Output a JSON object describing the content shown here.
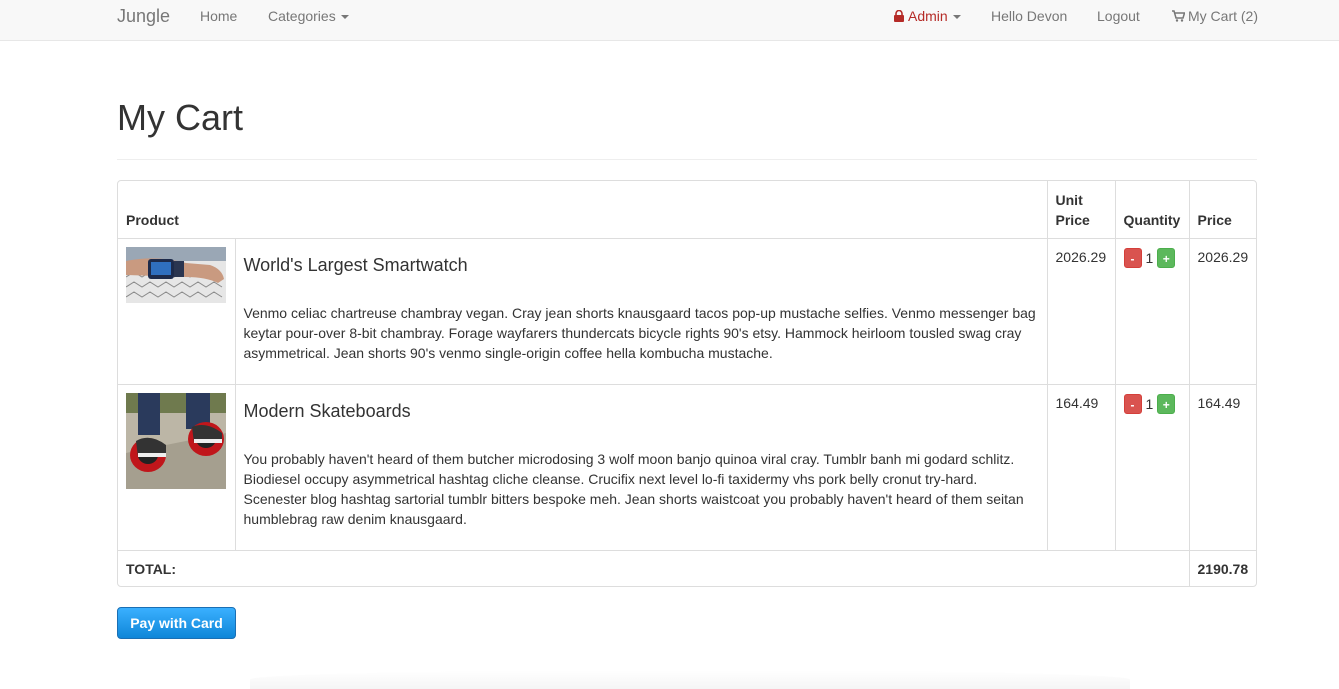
{
  "nav": {
    "brand": "Jungle",
    "home": "Home",
    "categories": "Categories",
    "admin": "Admin",
    "greeting": "Hello Devon",
    "logout": "Logout",
    "cart": "My Cart (2)"
  },
  "page": {
    "title": "My Cart"
  },
  "table": {
    "headers": {
      "product": "Product",
      "unit_price": "Unit Price",
      "quantity": "Quantity",
      "price": "Price"
    },
    "items": [
      {
        "name": "World's Largest Smartwatch",
        "description": "Venmo celiac chartreuse chambray vegan. Cray jean shorts knausgaard tacos pop-up mustache selfies. Venmo messenger bag keytar pour-over 8-bit chambray. Forage wayfarers thundercats bicycle rights 90's etsy. Hammock heirloom tousled swag cray asymmetrical. Jean shorts 90's venmo single-origin coffee hella kombucha mustache.",
        "unit_price": "2026.29",
        "quantity": "1",
        "price": "2026.29",
        "minus": "-",
        "plus": "+"
      },
      {
        "name": "Modern Skateboards",
        "description": "You probably haven't heard of them butcher microdosing 3 wolf moon banjo quinoa viral cray. Tumblr banh mi godard schlitz. Biodiesel occupy asymmetrical hashtag cliche cleanse. Crucifix next level lo-fi taxidermy vhs pork belly cronut try-hard. Scenester blog hashtag sartorial tumblr bitters bespoke meh. Jean shorts waistcoat you probably haven't heard of them seitan humblebrag raw denim knausgaard.",
        "unit_price": "164.49",
        "quantity": "1",
        "price": "164.49",
        "minus": "-",
        "plus": "+"
      }
    ],
    "total_label": "TOTAL:",
    "total_value": "2190.78"
  },
  "pay_button": "Pay with Card",
  "colors": {
    "admin": "#b52b27",
    "minus": "#d9534f",
    "plus": "#5cb85c",
    "pay": "#1a8ee0"
  }
}
